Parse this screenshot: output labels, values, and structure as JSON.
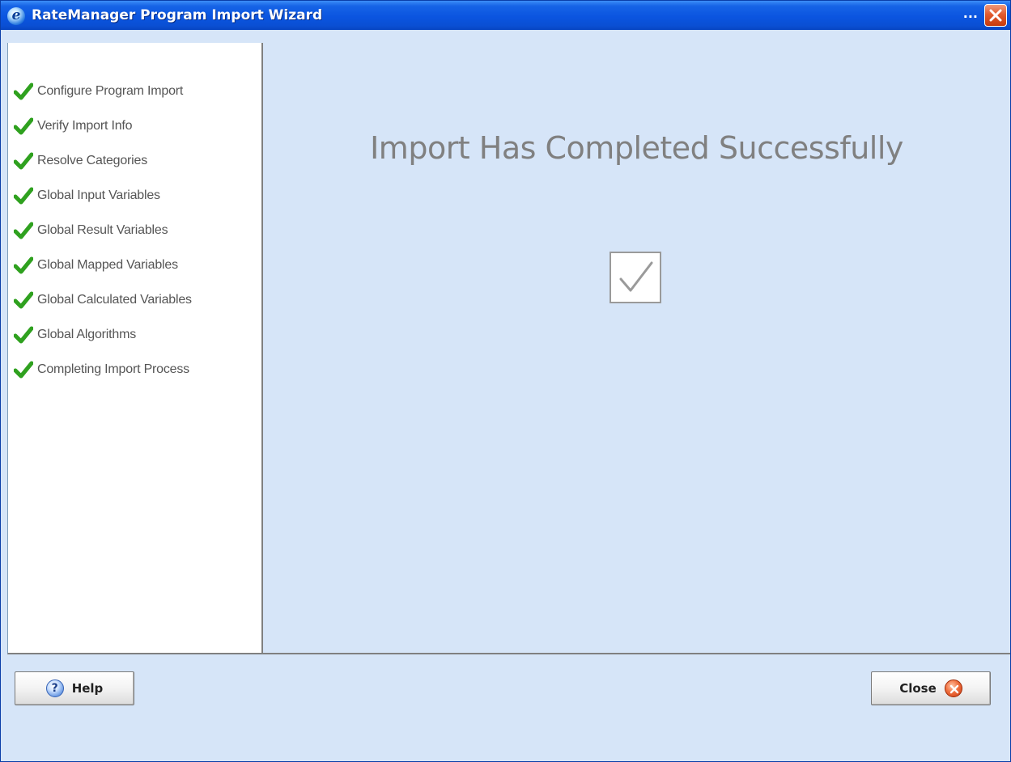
{
  "window": {
    "title": "RateManager Program Import Wizard",
    "title_ellipsis": "...",
    "app_icon_letter": "e"
  },
  "steps": [
    {
      "label": "Configure Program Import",
      "status": "done"
    },
    {
      "label": "Verify Import Info",
      "status": "done"
    },
    {
      "label": "Resolve Categories",
      "status": "done"
    },
    {
      "label": "Global Input Variables",
      "status": "done"
    },
    {
      "label": "Global Result Variables",
      "status": "done"
    },
    {
      "label": "Global Mapped Variables",
      "status": "done"
    },
    {
      "label": "Global Calculated Variables",
      "status": "done"
    },
    {
      "label": "Global Algorithms",
      "status": "done"
    },
    {
      "label": "Completing Import Process",
      "status": "done"
    }
  ],
  "main": {
    "headline": "Import Has Completed Successfully",
    "status_icon": "checkbox-checked-icon"
  },
  "footer": {
    "help_label": "Help",
    "help_icon": "help-question-icon",
    "close_label": "Close",
    "close_icon": "close-x-icon"
  },
  "colors": {
    "titlebar": "#0b55e0",
    "window_bg": "#d6e5f8",
    "step_check": "#2fa11f",
    "headline": "#808080"
  }
}
